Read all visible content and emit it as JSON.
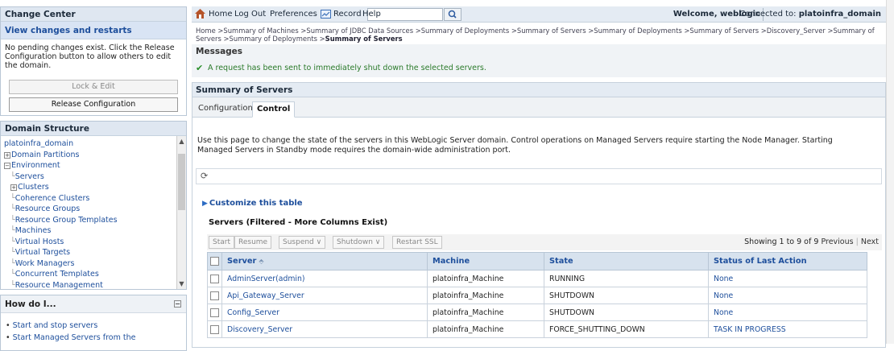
{
  "change_center": {
    "title": "Change Center",
    "view_changes_link": "View changes and restarts",
    "message": "No pending changes exist. Click the Release Configuration button to allow others to edit the domain.",
    "lock_edit_label": "Lock & Edit",
    "release_config_label": "Release Configuration"
  },
  "domain_structure": {
    "title": "Domain Structure",
    "items": [
      {
        "label": "platoinfra_domain",
        "expander": ""
      },
      {
        "label": "Domain Partitions",
        "expander": "+"
      },
      {
        "label": "Environment",
        "expander": "−"
      },
      {
        "label": "Servers",
        "expander": ""
      },
      {
        "label": "Clusters",
        "expander": "+"
      },
      {
        "label": "Coherence Clusters",
        "expander": ""
      },
      {
        "label": "Resource Groups",
        "expander": ""
      },
      {
        "label": "Resource Group Templates",
        "expander": ""
      },
      {
        "label": "Machines",
        "expander": ""
      },
      {
        "label": "Virtual Hosts",
        "expander": ""
      },
      {
        "label": "Virtual Targets",
        "expander": ""
      },
      {
        "label": "Work Managers",
        "expander": ""
      },
      {
        "label": "Concurrent Templates",
        "expander": ""
      },
      {
        "label": "Resource Management",
        "expander": ""
      }
    ]
  },
  "how_do_i": {
    "title": "How do I...",
    "items": [
      "Start and stop servers",
      "Start Managed Servers from the"
    ]
  },
  "topbar": {
    "home": "Home",
    "logout": "Log Out",
    "preferences": "Preferences",
    "record": "Record",
    "help": "Help",
    "search_value": "",
    "welcome": "Welcome, weblogic",
    "connected_prefix": "Connected to:",
    "connected_domain": "platoinfra_domain"
  },
  "breadcrumb": {
    "path": "Home >Summary of Machines >Summary of JDBC Data Sources >Summary of Deployments >Summary of Servers >Summary of Deployments >Summary of Servers >Discovery_Server >Summary of Servers >Summary of Deployments >",
    "current": "Summary of Servers"
  },
  "messages": {
    "title": "Messages",
    "text": "A request has been sent to immediately shut down the selected servers."
  },
  "main": {
    "title": "Summary of Servers",
    "tabs": [
      "Configuration",
      "Control"
    ],
    "description": "Use this page to change the state of the servers in this WebLogic Server domain. Control operations on Managed Servers require starting the Node Manager. Starting Managed Servers in Standby mode requires the domain-wide administration port.",
    "customize_link": "Customize this table",
    "table_title": "Servers (Filtered - More Columns Exist)",
    "actions": [
      "Start",
      "Resume",
      "Suspend ∨",
      "Shutdown ∨",
      "Restart SSL"
    ],
    "showing": "Showing 1 to 9 of 9",
    "previous": "Previous",
    "next": "Next",
    "columns": [
      "Server",
      "Machine",
      "State",
      "Status of Last Action"
    ],
    "rows": [
      {
        "server": "AdminServer(admin)",
        "machine": "platoinfra_Machine",
        "state": "RUNNING",
        "status": "None"
      },
      {
        "server": "Api_Gateway_Server",
        "machine": "platoinfra_Machine",
        "state": "SHUTDOWN",
        "status": "None"
      },
      {
        "server": "Config_Server",
        "machine": "platoinfra_Machine",
        "state": "SHUTDOWN",
        "status": "None"
      },
      {
        "server": "Discovery_Server",
        "machine": "platoinfra_Machine",
        "state": "FORCE_SHUTTING_DOWN",
        "status": "TASK IN PROGRESS"
      }
    ]
  },
  "colors": {
    "link": "#1e4f9c",
    "success": "#2a7a2a",
    "header_bg": "#d7e2ee"
  }
}
